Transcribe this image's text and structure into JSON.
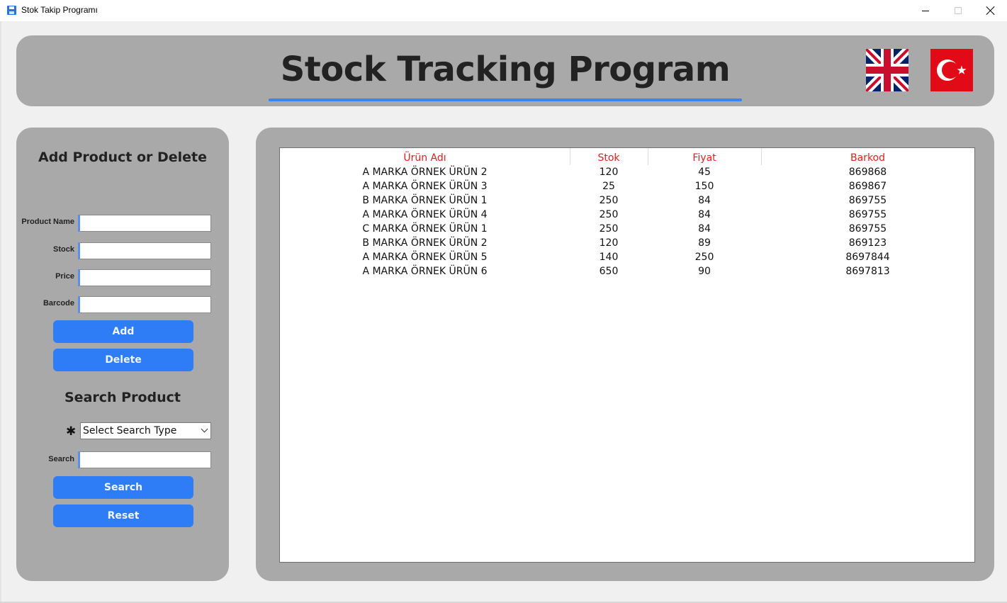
{
  "window": {
    "title": "Stok Takip Programı",
    "icon": "floppy-disk-icon"
  },
  "header": {
    "title": "Stock Tracking Program",
    "flags": [
      "uk-flag-icon",
      "turkey-flag-icon"
    ]
  },
  "add_panel": {
    "title": "Add Product or Delete",
    "fields": {
      "product_name": {
        "label": "Product Name",
        "value": ""
      },
      "stock": {
        "label": "Stock",
        "value": ""
      },
      "price": {
        "label": "Price",
        "value": ""
      },
      "barcode": {
        "label": "Barcode",
        "value": ""
      }
    },
    "add_label": "Add",
    "delete_label": "Delete"
  },
  "search_panel": {
    "title": "Search Product",
    "required_mark": "✱",
    "search_type": "Select Search Type",
    "search_label": "Search",
    "search_value": "",
    "search_button": "Search",
    "reset_button": "Reset"
  },
  "table": {
    "headers": [
      "Ürün Adı",
      "Stok",
      "Fiyat",
      "Barkod"
    ],
    "rows": [
      [
        "A MARKA ÖRNEK ÜRÜN 2",
        "120",
        "45",
        "869868"
      ],
      [
        "A MARKA ÖRNEK ÜRÜN 3",
        "25",
        "150",
        "869867"
      ],
      [
        "B MARKA ÖRNEK ÜRÜN 1",
        "250",
        "84",
        "869755"
      ],
      [
        "A MARKA ÖRNEK ÜRÜN 4",
        "250",
        "84",
        "869755"
      ],
      [
        "C MARKA ÖRNEK ÜRÜN 1",
        "250",
        "84",
        "869755"
      ],
      [
        "B MARKA ÖRNEK ÜRÜN 2",
        "120",
        "89",
        "869123"
      ],
      [
        "A MARKA ÖRNEK ÜRÜN 5",
        "140",
        "250",
        "8697844"
      ],
      [
        "A MARKA ÖRNEK ÜRÜN 6",
        "650",
        "90",
        "8697813"
      ]
    ]
  },
  "colors": {
    "panel": "#a9a9a9",
    "accent": "#2e7cf6",
    "header_text": "#e02020"
  }
}
